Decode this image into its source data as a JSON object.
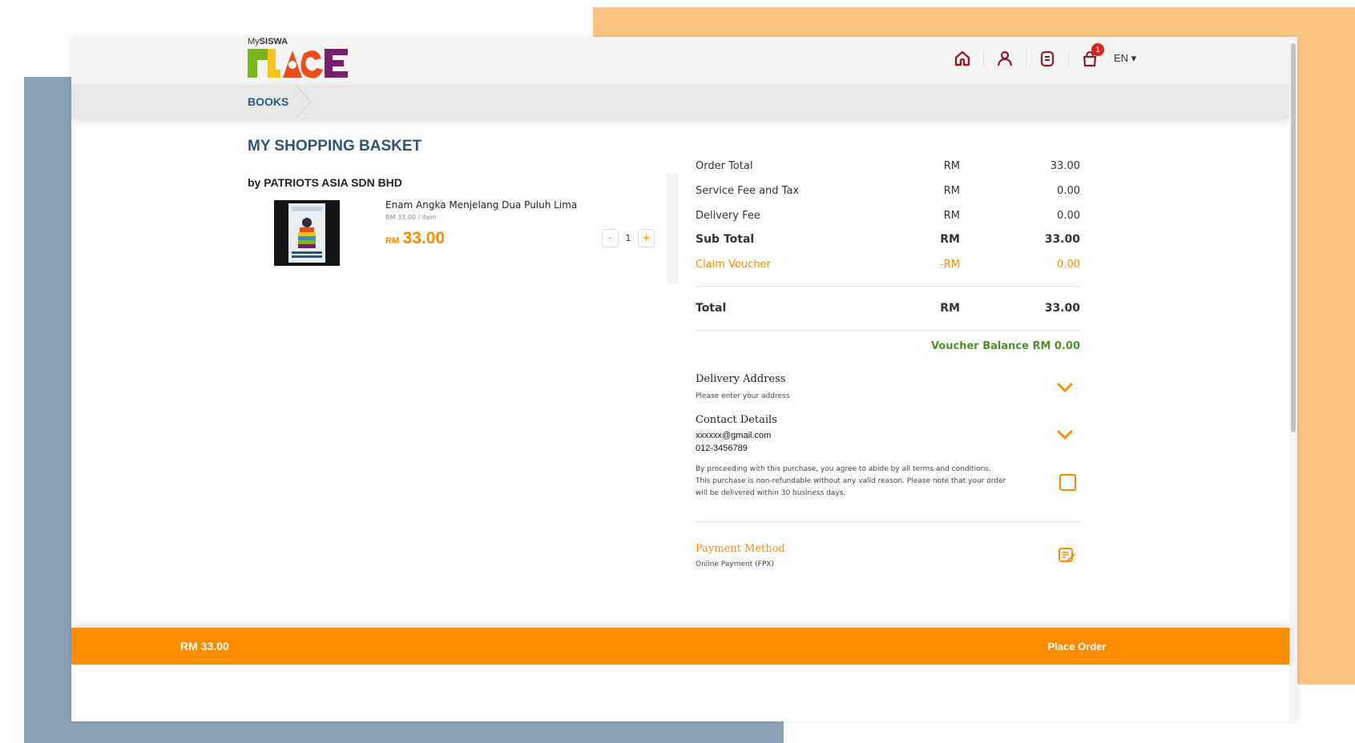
{
  "brand": {
    "prefix": "My",
    "name": "SISWA",
    "logo_text": "PLACE"
  },
  "header": {
    "icons": [
      "home-icon",
      "user-icon",
      "wallet-icon",
      "basket-icon"
    ],
    "cart_count": "1",
    "language": "EN"
  },
  "breadcrumb": {
    "label": "BOOKS"
  },
  "page": {
    "title": "MY SHOPPING BASKET"
  },
  "basket": {
    "seller": "by PATRIOTS ASIA SDN BHD",
    "item": {
      "name": "Enam Angka Menjelang Dua Puluh Lima",
      "unit_price": "RM 33.00 / item",
      "currency": "RM",
      "price": "33.00",
      "quantity": "1",
      "minus": "-",
      "plus": "+"
    }
  },
  "summary": {
    "order_total": {
      "label": "Order Total",
      "currency": "RM",
      "value": "33.00"
    },
    "service_fee": {
      "label": "Service Fee and Tax",
      "currency": "RM",
      "value": "0.00"
    },
    "delivery_fee": {
      "label": "Delivery Fee",
      "currency": "RM",
      "value": "0.00"
    },
    "sub_total": {
      "label": "Sub Total",
      "currency": "RM",
      "value": "33.00"
    },
    "claim_voucher": {
      "label": "Claim Voucher",
      "currency": "-RM",
      "value": "0.00"
    },
    "total": {
      "label": "Total",
      "currency": "RM",
      "value": "33.00"
    },
    "voucher_balance": "Voucher Balance RM 0.00"
  },
  "delivery": {
    "title": "Delivery Address",
    "placeholder": "Please enter your address"
  },
  "contact": {
    "title": "Contact Details",
    "email": "xxxxxx@gmail.com",
    "phone": "012-3456789"
  },
  "terms": {
    "text": "By proceeding with this purchase, you agree to abide by all terms and conditions. This purchase is non-refundable without any valid reason. Please note that your order will be delivered within 30 business days.",
    "checked": false
  },
  "payment": {
    "title": "Payment Method",
    "value": "Online Payment (FPX)"
  },
  "footer": {
    "total": "RM 33.00",
    "place_order": "Place Order"
  },
  "colors": {
    "accent": "#ff8c00",
    "title_blue": "#2f5378",
    "icon_maroon": "#8b1d2c",
    "voucher_green": "#4f8e2a",
    "bg_blue": "#8aa1b6",
    "bg_orange": "#fcc384"
  }
}
